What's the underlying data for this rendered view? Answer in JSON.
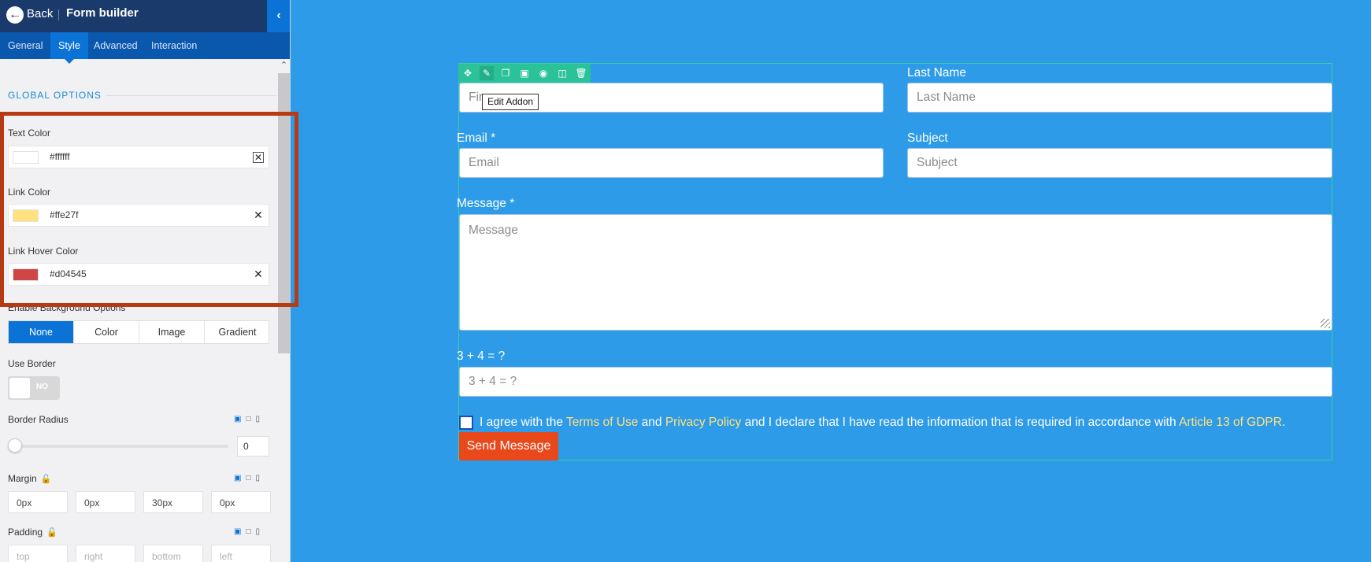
{
  "topbar": {
    "back_label": "Back",
    "title": "Form builder"
  },
  "tabs": [
    {
      "label": "General"
    },
    {
      "label": "Style"
    },
    {
      "label": "Advanced"
    },
    {
      "label": "Interaction"
    }
  ],
  "panel": {
    "section_title": "GLOBAL OPTIONS",
    "text_color": {
      "label": "Text Color",
      "value": "#ffffff",
      "swatch": "#ffffff"
    },
    "link_color": {
      "label": "Link Color",
      "value": "#ffe27f",
      "swatch": "#ffe27f"
    },
    "link_hover_color": {
      "label": "Link Hover Color",
      "value": "#d04545",
      "swatch": "#d04545"
    },
    "bg_options": {
      "label": "Enable Background Options",
      "options": [
        "None",
        "Color",
        "Image",
        "Gradient"
      ],
      "selected": "None"
    },
    "use_border": {
      "label": "Use Border",
      "state": "NO"
    },
    "border_radius": {
      "label": "Border Radius",
      "value": "0"
    },
    "margin": {
      "label": "Margin",
      "values": [
        "0px",
        "0px",
        "30px",
        "0px"
      ]
    },
    "padding": {
      "label": "Padding",
      "placeholders": [
        "top",
        "right",
        "bottom",
        "left"
      ]
    }
  },
  "form": {
    "tooltip": "Edit Addon",
    "first_name_placeholder": "Fir",
    "last_name_label": "Last Name",
    "last_name_placeholder": "Last Name",
    "email_label": "Email *",
    "email_placeholder": "Email",
    "subject_label": "Subject",
    "subject_placeholder": "Subject",
    "message_label": "Message *",
    "message_placeholder": "Message",
    "captcha_label": "3 + 4 = ?",
    "captcha_placeholder": "3 + 4 = ?",
    "agree_parts": {
      "t1": "I agree with the ",
      "l1": "Terms of Use",
      "t2": " and ",
      "l2": "Privacy Policy",
      "t3": " and I declare that I have read the information that is required in accordance with ",
      "l3": "Article 13 of GDPR",
      "t4": "."
    },
    "send_label": "Send Message"
  },
  "colors": {
    "canvas_bg": "#2d9be8",
    "topbar_bg": "#1a3a6b",
    "tabs_bg": "#0a57ae",
    "accent": "#0b73d6",
    "highlight_box": "#b83a12",
    "toolbar": "#2bc29a",
    "send_button": "#e9481a",
    "link": "#ffe27f"
  }
}
